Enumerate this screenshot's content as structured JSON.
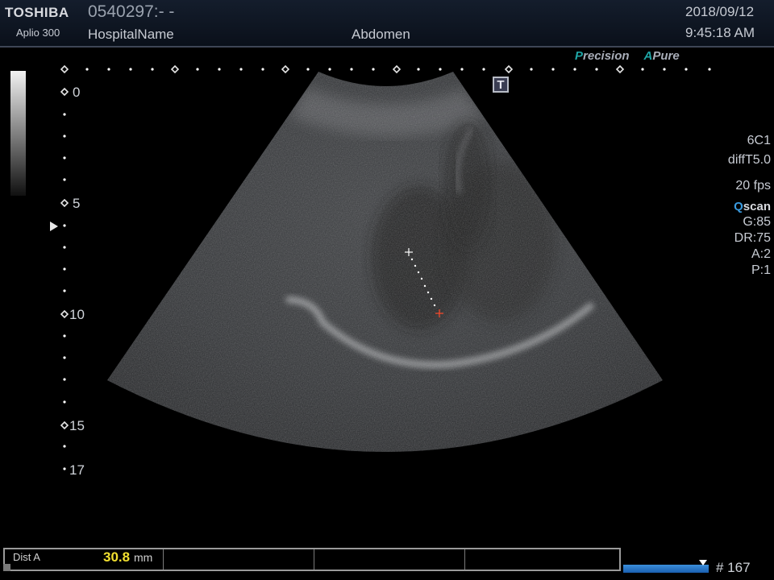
{
  "header": {
    "brand": "TOSHIBA",
    "model": "Aplio 300",
    "patient_id": "0540297:- -",
    "hospital": "HospitalName",
    "preset": "Abdomen",
    "date": "2018/09/12",
    "time": "9:45:18 AM"
  },
  "image_features": {
    "precision_accent": "P",
    "precision_rest": "recision",
    "apure_accent": "A",
    "apure_rest": "Pure"
  },
  "t_marker": "T",
  "params": {
    "probe": "6C1",
    "mode": "diffT5.0",
    "fps": "20 fps",
    "qscan_q": "Q",
    "qscan_rest": "scan",
    "gain": "G:85",
    "dynamic_range": "DR:75",
    "a": "A:2",
    "p": "P:1"
  },
  "depth_scale": {
    "labels": [
      "0",
      "5",
      "10",
      "15",
      "17"
    ]
  },
  "measurement": {
    "label": "Dist A",
    "value": "30.8",
    "unit": "mm"
  },
  "cine": {
    "frame_count": "# 167"
  },
  "colors": {
    "header_bg": "#0f1724",
    "accent_teal": "#1fa5a5",
    "measure_yellow": "#f2e030",
    "cine_blue": "#2a7fd0"
  }
}
